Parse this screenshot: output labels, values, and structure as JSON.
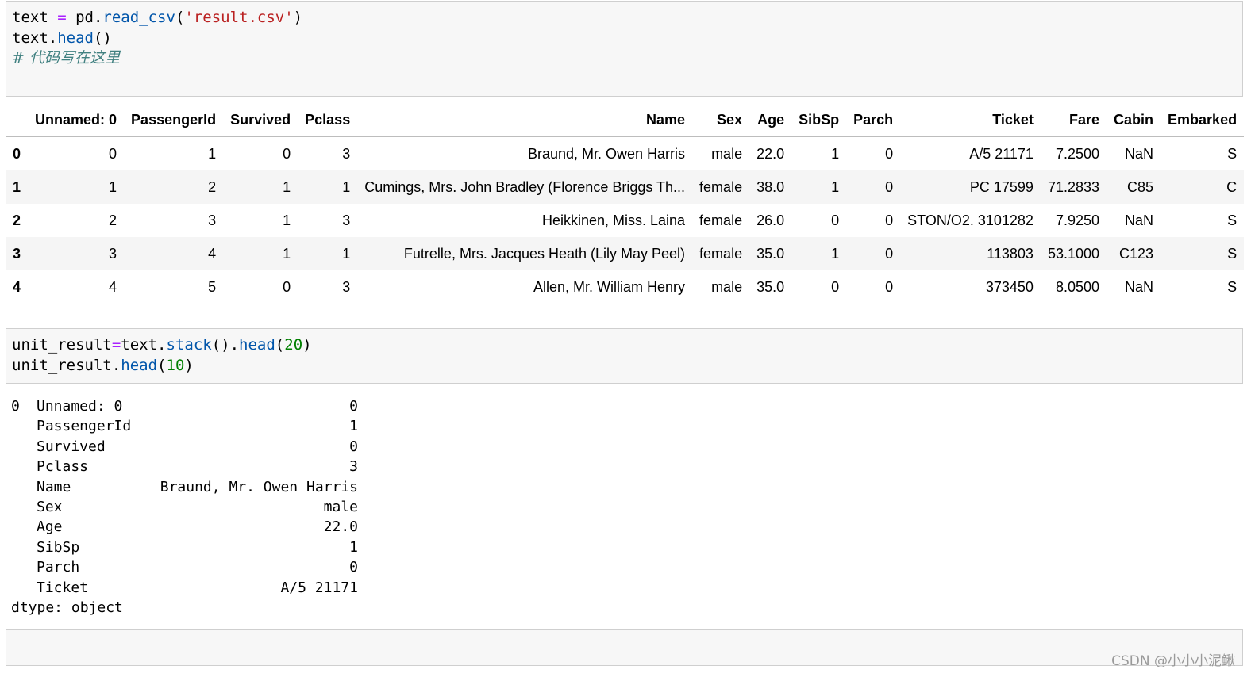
{
  "cell1": {
    "lines": [
      [
        {
          "t": "text ",
          "c": ""
        },
        {
          "t": "=",
          "c": "op"
        },
        {
          "t": " pd.",
          "c": ""
        },
        {
          "t": "read_csv",
          "c": "fn"
        },
        {
          "t": "(",
          "c": ""
        },
        {
          "t": "'result.csv'",
          "c": "str"
        },
        {
          "t": ")",
          "c": ""
        }
      ],
      [
        {
          "t": "text.",
          "c": ""
        },
        {
          "t": "head",
          "c": "fn"
        },
        {
          "t": "()",
          "c": ""
        }
      ],
      [
        {
          "t": "# 代码写在这里",
          "c": "comment"
        }
      ]
    ]
  },
  "dataframe": {
    "columns": [
      "",
      "Unnamed: 0",
      "PassengerId",
      "Survived",
      "Pclass",
      "Name",
      "Sex",
      "Age",
      "SibSp",
      "Parch",
      "Ticket",
      "Fare",
      "Cabin",
      "Embarked"
    ],
    "rows": [
      [
        "0",
        "0",
        "1",
        "0",
        "3",
        "Braund, Mr. Owen Harris",
        "male",
        "22.0",
        "1",
        "0",
        "A/5 21171",
        "7.2500",
        "NaN",
        "S"
      ],
      [
        "1",
        "1",
        "2",
        "1",
        "1",
        "Cumings, Mrs. John Bradley (Florence Briggs Th...",
        "female",
        "38.0",
        "1",
        "0",
        "PC 17599",
        "71.2833",
        "C85",
        "C"
      ],
      [
        "2",
        "2",
        "3",
        "1",
        "3",
        "Heikkinen, Miss. Laina",
        "female",
        "26.0",
        "0",
        "0",
        "STON/O2. 3101282",
        "7.9250",
        "NaN",
        "S"
      ],
      [
        "3",
        "3",
        "4",
        "1",
        "1",
        "Futrelle, Mrs. Jacques Heath (Lily May Peel)",
        "female",
        "35.0",
        "1",
        "0",
        "113803",
        "53.1000",
        "C123",
        "S"
      ],
      [
        "4",
        "4",
        "5",
        "0",
        "3",
        "Allen, Mr. William Henry",
        "male",
        "35.0",
        "0",
        "0",
        "373450",
        "8.0500",
        "NaN",
        "S"
      ]
    ]
  },
  "cell2": {
    "lines": [
      [
        {
          "t": "unit_result",
          "c": ""
        },
        {
          "t": "=",
          "c": "op"
        },
        {
          "t": "text.",
          "c": ""
        },
        {
          "t": "stack",
          "c": "fn"
        },
        {
          "t": "().",
          "c": ""
        },
        {
          "t": "head",
          "c": "fn"
        },
        {
          "t": "(",
          "c": ""
        },
        {
          "t": "20",
          "c": "num"
        },
        {
          "t": ")",
          "c": ""
        }
      ],
      [
        {
          "t": "unit_result.",
          "c": ""
        },
        {
          "t": "head",
          "c": "fn"
        },
        {
          "t": "(",
          "c": ""
        },
        {
          "t": "10",
          "c": "num"
        },
        {
          "t": ")",
          "c": ""
        }
      ]
    ]
  },
  "series_output": {
    "first_index": "0",
    "rows": [
      {
        "key": "Unnamed: 0",
        "value": "0"
      },
      {
        "key": "PassengerId",
        "value": "1"
      },
      {
        "key": "Survived",
        "value": "0"
      },
      {
        "key": "Pclass",
        "value": "3"
      },
      {
        "key": "Name",
        "value": "Braund, Mr. Owen Harris"
      },
      {
        "key": "Sex",
        "value": "male"
      },
      {
        "key": "Age",
        "value": "22.0"
      },
      {
        "key": "SibSp",
        "value": "1"
      },
      {
        "key": "Parch",
        "value": "0"
      },
      {
        "key": "Ticket",
        "value": "A/5 21171"
      }
    ],
    "dtype_line": "dtype: object"
  },
  "watermark": "CSDN @小小小泥鳅"
}
